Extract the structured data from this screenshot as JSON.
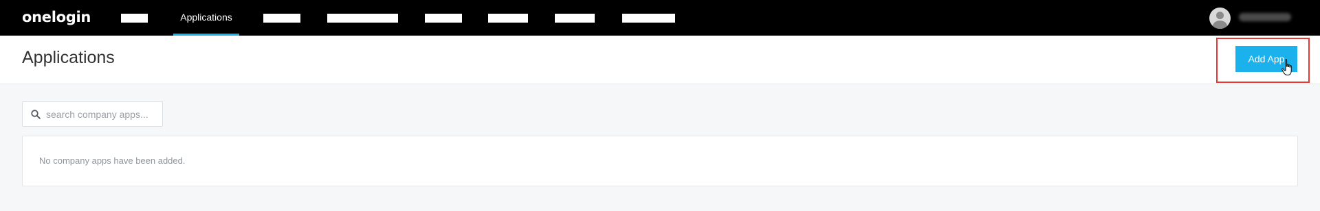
{
  "app": {
    "logo_text": "onelogin",
    "accent_color": "#1ab1ec"
  },
  "nav": {
    "active_item": "Applications",
    "redacted_items": 7
  },
  "user": {
    "avatar_icon": "user-avatar-icon"
  },
  "header": {
    "title": "Applications",
    "add_button_label": "Add App"
  },
  "search": {
    "placeholder": "search company apps...",
    "value": "",
    "icon": "search-icon"
  },
  "content": {
    "empty_message": "No company apps have been added."
  }
}
